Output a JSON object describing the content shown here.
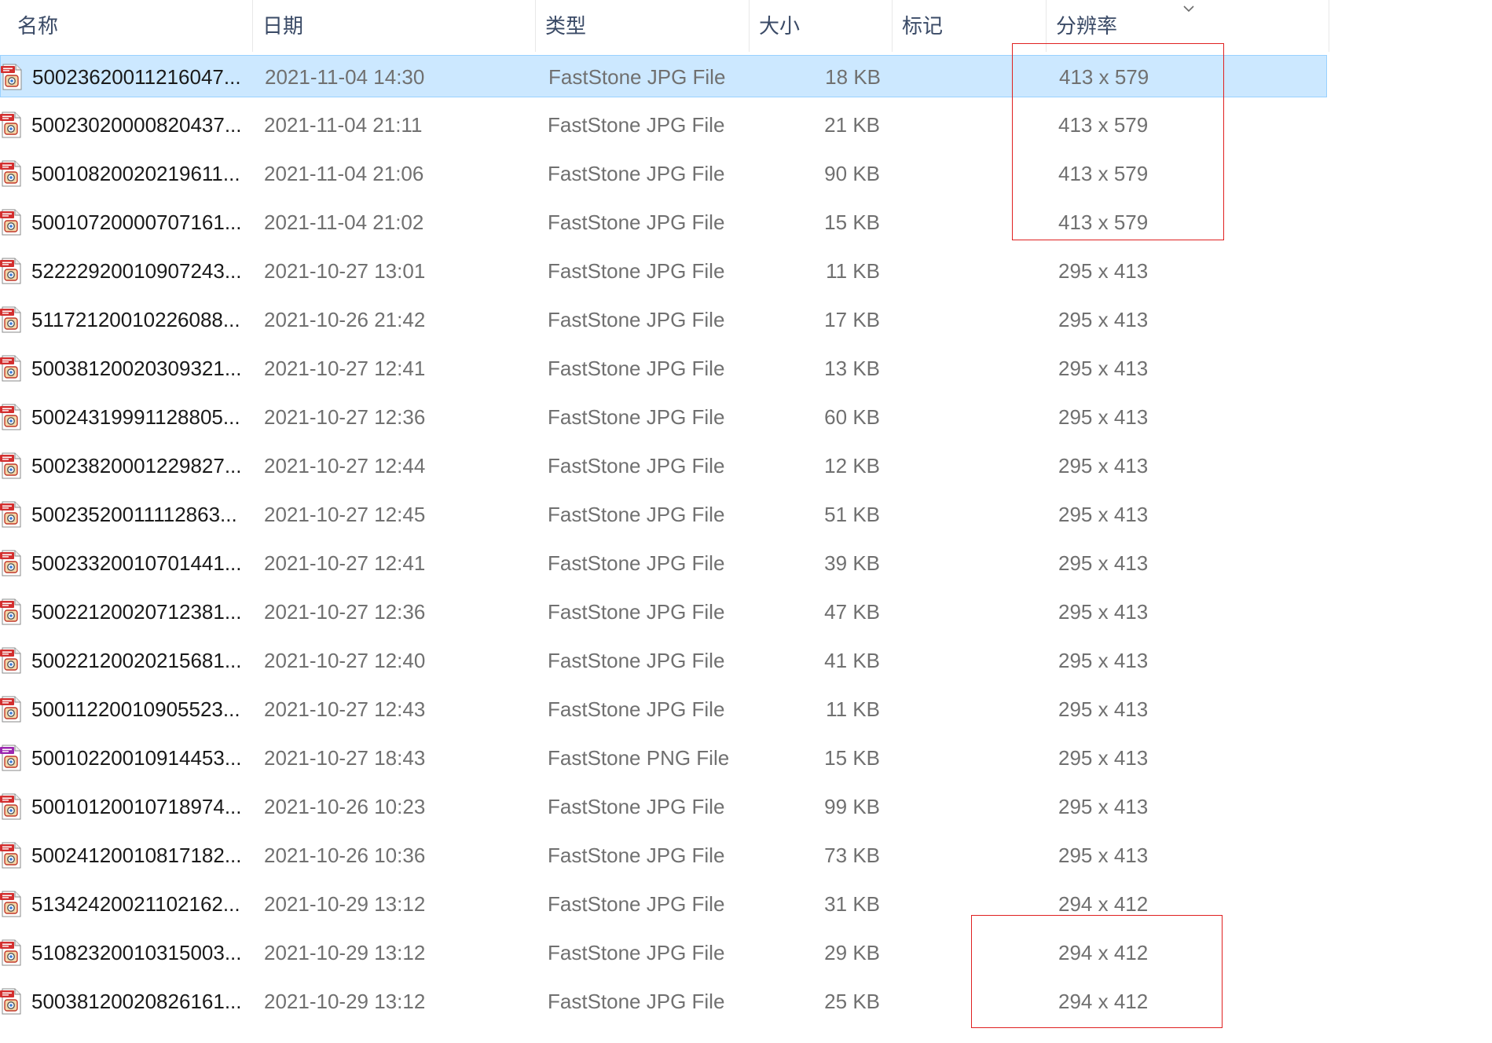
{
  "columns": {
    "name": "名称",
    "date": "日期",
    "type": "类型",
    "size": "大小",
    "tags": "标记",
    "resolution": "分辨率"
  },
  "files": [
    {
      "name": "50023620011216047...",
      "date": "2021-11-04 14:30",
      "type": "FastStone JPG File",
      "size": "18 KB",
      "resolution": "413 x 579",
      "icon": "jpg-file-icon",
      "selected": true
    },
    {
      "name": "50023020000820437...",
      "date": "2021-11-04 21:11",
      "type": "FastStone JPG File",
      "size": "21 KB",
      "resolution": "413 x 579",
      "icon": "jpg-file-icon"
    },
    {
      "name": "50010820020219611...",
      "date": "2021-11-04 21:06",
      "type": "FastStone JPG File",
      "size": "90 KB",
      "resolution": "413 x 579",
      "icon": "jpg-file-icon"
    },
    {
      "name": "50010720000707161...",
      "date": "2021-11-04 21:02",
      "type": "FastStone JPG File",
      "size": "15 KB",
      "resolution": "413 x 579",
      "icon": "jpg-file-icon"
    },
    {
      "name": "52222920010907243...",
      "date": "2021-10-27 13:01",
      "type": "FastStone JPG File",
      "size": "11 KB",
      "resolution": "295 x 413",
      "icon": "jpg-file-icon"
    },
    {
      "name": "51172120010226088...",
      "date": "2021-10-26 21:42",
      "type": "FastStone JPG File",
      "size": "17 KB",
      "resolution": "295 x 413",
      "icon": "jpg-file-icon"
    },
    {
      "name": "50038120020309321...",
      "date": "2021-10-27 12:41",
      "type": "FastStone JPG File",
      "size": "13 KB",
      "resolution": "295 x 413",
      "icon": "jpg-file-icon"
    },
    {
      "name": "50024319991128805...",
      "date": "2021-10-27 12:36",
      "type": "FastStone JPG File",
      "size": "60 KB",
      "resolution": "295 x 413",
      "icon": "jpg-file-icon"
    },
    {
      "name": "50023820001229827...",
      "date": "2021-10-27 12:44",
      "type": "FastStone JPG File",
      "size": "12 KB",
      "resolution": "295 x 413",
      "icon": "jpg-file-icon"
    },
    {
      "name": "50023520011112863...",
      "date": "2021-10-27 12:45",
      "type": "FastStone JPG File",
      "size": "51 KB",
      "resolution": "295 x 413",
      "icon": "jpg-file-icon"
    },
    {
      "name": "50023320010701441...",
      "date": "2021-10-27 12:41",
      "type": "FastStone JPG File",
      "size": "39 KB",
      "resolution": "295 x 413",
      "icon": "jpg-file-icon"
    },
    {
      "name": "50022120020712381...",
      "date": "2021-10-27 12:36",
      "type": "FastStone JPG File",
      "size": "47 KB",
      "resolution": "295 x 413",
      "icon": "jpg-file-icon"
    },
    {
      "name": "50022120020215681...",
      "date": "2021-10-27 12:40",
      "type": "FastStone JPG File",
      "size": "41 KB",
      "resolution": "295 x 413",
      "icon": "jpg-file-icon"
    },
    {
      "name": "50011220010905523...",
      "date": "2021-10-27 12:43",
      "type": "FastStone JPG File",
      "size": "11 KB",
      "resolution": "295 x 413",
      "icon": "jpg-file-icon"
    },
    {
      "name": "50010220010914453...",
      "date": "2021-10-27 18:43",
      "type": "FastStone PNG File",
      "size": "15 KB",
      "resolution": "295 x 413",
      "icon": "png-file-icon"
    },
    {
      "name": "50010120010718974...",
      "date": "2021-10-26 10:23",
      "type": "FastStone JPG File",
      "size": "99 KB",
      "resolution": "295 x 413",
      "icon": "jpg-file-icon"
    },
    {
      "name": "50024120010817182...",
      "date": "2021-10-26 10:36",
      "type": "FastStone JPG File",
      "size": "73 KB",
      "resolution": "295 x 413",
      "icon": "jpg-file-icon"
    },
    {
      "name": "51342420021102162...",
      "date": "2021-10-29 13:12",
      "type": "FastStone JPG File",
      "size": "31 KB",
      "resolution": "294 x 412",
      "icon": "jpg-file-icon"
    },
    {
      "name": "51082320010315003...",
      "date": "2021-10-29 13:12",
      "type": "FastStone JPG File",
      "size": "29 KB",
      "resolution": "294 x 412",
      "icon": "jpg-file-icon"
    },
    {
      "name": "50038120020826161...",
      "date": "2021-10-29 13:12",
      "type": "FastStone JPG File",
      "size": "25 KB",
      "resolution": "294 x 412",
      "icon": "jpg-file-icon"
    }
  ],
  "colors": {
    "selection_bg": "#cce8ff",
    "selection_border": "#99d1ff",
    "annotation": "#e02020",
    "header_text": "#3a4a66",
    "jpg_badge": "#d32f2f",
    "png_badge": "#9c27b0"
  }
}
